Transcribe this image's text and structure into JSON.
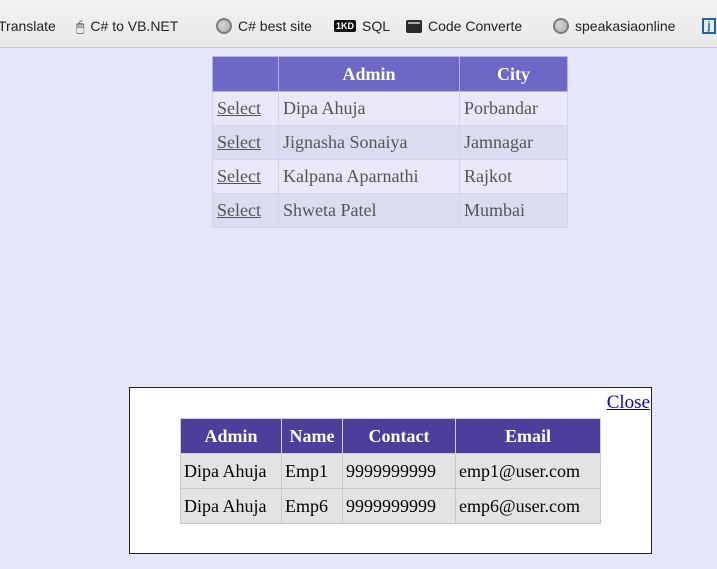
{
  "bookmarks": [
    {
      "label": "Translate",
      "icon": "none"
    },
    {
      "label": "C# to VB.NET",
      "icon": "mouse-icon"
    },
    {
      "label": "C# best site",
      "icon": "globe-icon"
    },
    {
      "label": "SQL",
      "icon": "kd-icon",
      "badge": "1KD"
    },
    {
      "label": "Code Converte",
      "icon": "terminal-icon"
    },
    {
      "label": "speakasiaonline",
      "icon": "globe-icon"
    },
    {
      "label": "",
      "icon": "j-icon",
      "badge": "j"
    }
  ],
  "grid1": {
    "headers": [
      "",
      "Admin",
      "City"
    ],
    "rows": [
      {
        "action": "Select",
        "admin": "Dipa Ahuja",
        "city": "Porbandar"
      },
      {
        "action": "Select",
        "admin": "Jignasha Sonaiya",
        "city": "Jamnagar"
      },
      {
        "action": "Select",
        "admin": "Kalpana Aparnathi",
        "city": "Rajkot"
      },
      {
        "action": "Select",
        "admin": "Shweta Patel",
        "city": "Mumbai"
      }
    ]
  },
  "popup": {
    "close_label": "Close",
    "headers": [
      "Admin",
      "Name",
      "Contact",
      "Email"
    ],
    "rows": [
      {
        "admin": "Dipa Ahuja",
        "name": "Emp1",
        "contact": "9999999999",
        "email": "emp1@user.com"
      },
      {
        "admin": "Dipa Ahuja",
        "name": "Emp6",
        "contact": "9999999999",
        "email": "emp6@user.com"
      }
    ]
  },
  "colors": {
    "page_bg": "#e6e6fa",
    "grid1_header": "#6d68c6",
    "grid2_header": "#4b3f9b",
    "link": "#0000ee"
  }
}
